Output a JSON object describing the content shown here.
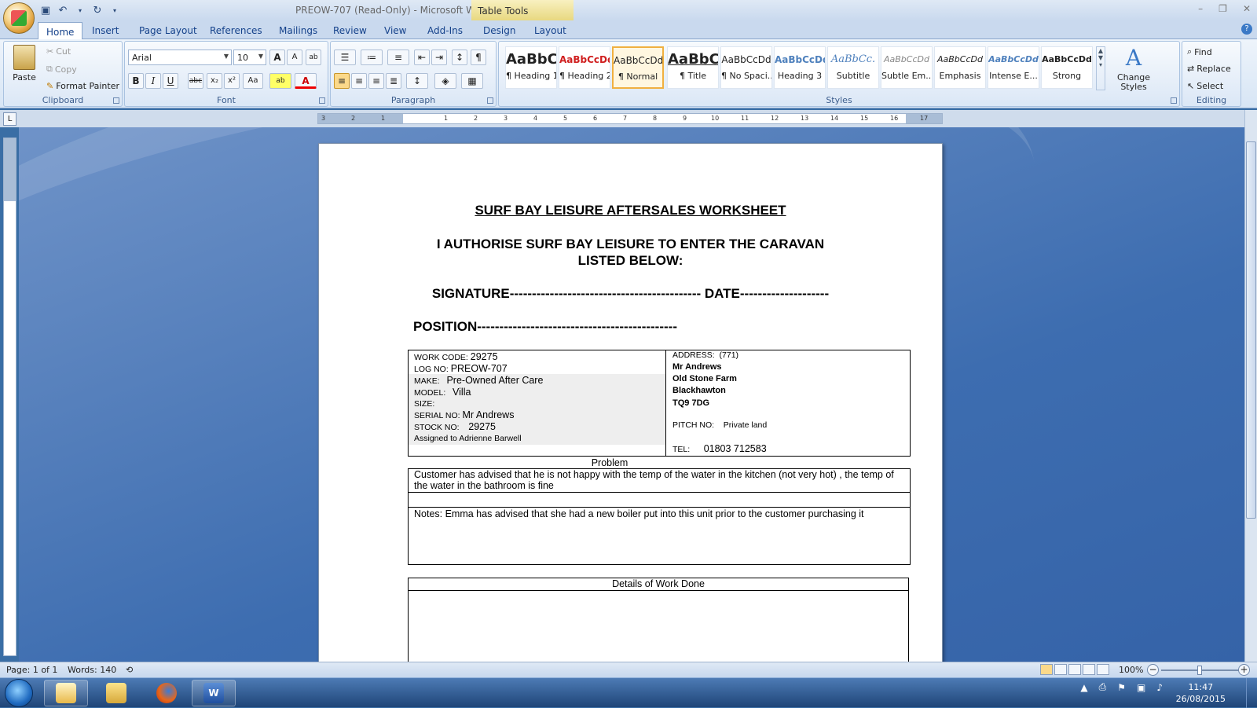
{
  "window": {
    "title": "PREOW-707 (Read-Only) - Microsoft Word",
    "context_tab": "Table Tools"
  },
  "tabs": [
    "Home",
    "Insert",
    "Page Layout",
    "References",
    "Mailings",
    "Review",
    "View",
    "Add-Ins",
    "Design",
    "Layout"
  ],
  "ribbon": {
    "clipboard": {
      "label": "Clipboard",
      "paste": "Paste",
      "cut": "Cut",
      "copy": "Copy",
      "format_painter": "Format Painter"
    },
    "font": {
      "label": "Font",
      "family": "Arial",
      "size": "10"
    },
    "paragraph": {
      "label": "Paragraph"
    },
    "styles": {
      "label": "Styles",
      "items": [
        {
          "sample": "AaBbC",
          "name": "¶ Heading 1"
        },
        {
          "sample": "AaBbCcDd",
          "name": "¶ Heading 2"
        },
        {
          "sample": "AaBbCcDd",
          "name": "¶ Normal"
        },
        {
          "sample": "AaBbC",
          "name": "¶ Title"
        },
        {
          "sample": "AaBbCcDd",
          "name": "¶ No Spaci..."
        },
        {
          "sample": "AaBbCcDd",
          "name": "Heading 3"
        },
        {
          "sample": "AaBbCc.",
          "name": "Subtitle"
        },
        {
          "sample": "AaBbCcDd",
          "name": "Subtle Em..."
        },
        {
          "sample": "AaBbCcDd",
          "name": "Emphasis"
        },
        {
          "sample": "AaBbCcDd",
          "name": "Intense E..."
        },
        {
          "sample": "AaBbCcDd",
          "name": "Strong"
        }
      ],
      "change_styles": "Change Styles"
    },
    "editing": {
      "label": "Editing",
      "find": "Find",
      "replace": "Replace",
      "select": "Select"
    }
  },
  "ruler": {
    "ticks": [
      "3",
      "2",
      "1",
      "1",
      "2",
      "3",
      "4",
      "5",
      "6",
      "7",
      "8",
      "9",
      "10",
      "11",
      "12",
      "13",
      "14",
      "15",
      "16",
      "17"
    ]
  },
  "doc": {
    "title": "SURF BAY LEISURE AFTERSALES WORKSHEET",
    "authorise1": "I AUTHORISE SURF BAY LEISURE TO ENTER THE CARAVAN",
    "authorise2": "LISTED BELOW:",
    "signature": "SIGNATURE------------------------------------------- DATE--------------------",
    "position": "POSITION---------------------------------------------",
    "left": {
      "work_code_label": "WORK CODE:",
      "work_code": "29275",
      "log_no_label": "LOG NO:",
      "log_no": "PREOW-707",
      "make_label": "MAKE:",
      "make": "Pre-Owned  After Care",
      "model_label": "MODEL:",
      "model": "Villa",
      "size_label": "SIZE:",
      "serial_label": "SERIAL NO:",
      "serial": "Mr Andrews",
      "stock_label": "STOCK NO:",
      "stock": "29275",
      "assigned": "Assigned to Adrienne Barwell"
    },
    "right": {
      "address_label": "ADDRESS:",
      "address_code": "(771)",
      "name": "Mr Andrews",
      "line1": "Old Stone Farm",
      "line2": "Blackhawton",
      "postcode": "TQ9 7DG",
      "pitch_label": "PITCH NO:",
      "pitch": "Private land",
      "tel_label": "TEL:",
      "tel": "01803  712583"
    },
    "problem_caption": "Problem",
    "problem": "Customer has advised that he is not happy with the temp of the water in the kitchen (not very hot) , the temp of the water in the bathroom is fine",
    "notes": "Notes:   Emma has advised that she had a new boiler put into this unit prior to the customer purchasing it",
    "details_caption": "Details of Work Done"
  },
  "status": {
    "page": "Page: 1 of 1",
    "words": "Words: 140",
    "zoom": "100%"
  },
  "taskbar": {
    "time": "11:47",
    "date": "26/08/2015"
  }
}
